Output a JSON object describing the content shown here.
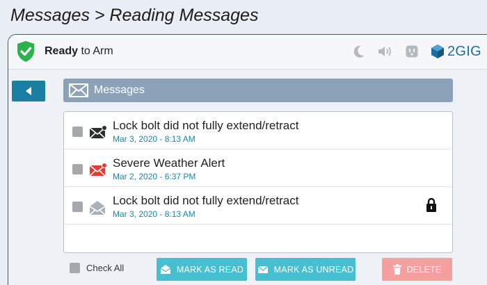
{
  "caption": "Messages > Reading Messages",
  "status": {
    "bold": "Ready",
    "rest": " to Arm"
  },
  "brand": {
    "name": "2GIG",
    "color": "#1e6fa1"
  },
  "icons": [
    "moon-icon",
    "speaker-icon",
    "outlet-icon",
    "brand-logo-icon"
  ],
  "header": {
    "title": "Messages"
  },
  "messages": [
    {
      "subject": "Lock bolt did not fully extend/retract",
      "date": "Mar 3, 2020 - 8:13 AM",
      "state": "unread",
      "locked": false
    },
    {
      "subject": "Severe Weather Alert",
      "date": "Mar 2, 2020 - 6:37 PM",
      "state": "unread-alert",
      "locked": false
    },
    {
      "subject": "Lock bolt did not fully extend/retract",
      "date": "Mar 3, 2020 - 8:13 AM",
      "state": "read",
      "locked": true
    }
  ],
  "footer": {
    "check_all": "Check All",
    "mark_read": "MARK AS READ",
    "mark_unread": "MARK AS UNREAD",
    "delete": "DELETE"
  },
  "colors": {
    "accent": "#1a7fa3",
    "button": "#47bfd0",
    "delete": "#f4a0a0",
    "alert": "#e63a2e",
    "ok": "#2bb24c"
  }
}
